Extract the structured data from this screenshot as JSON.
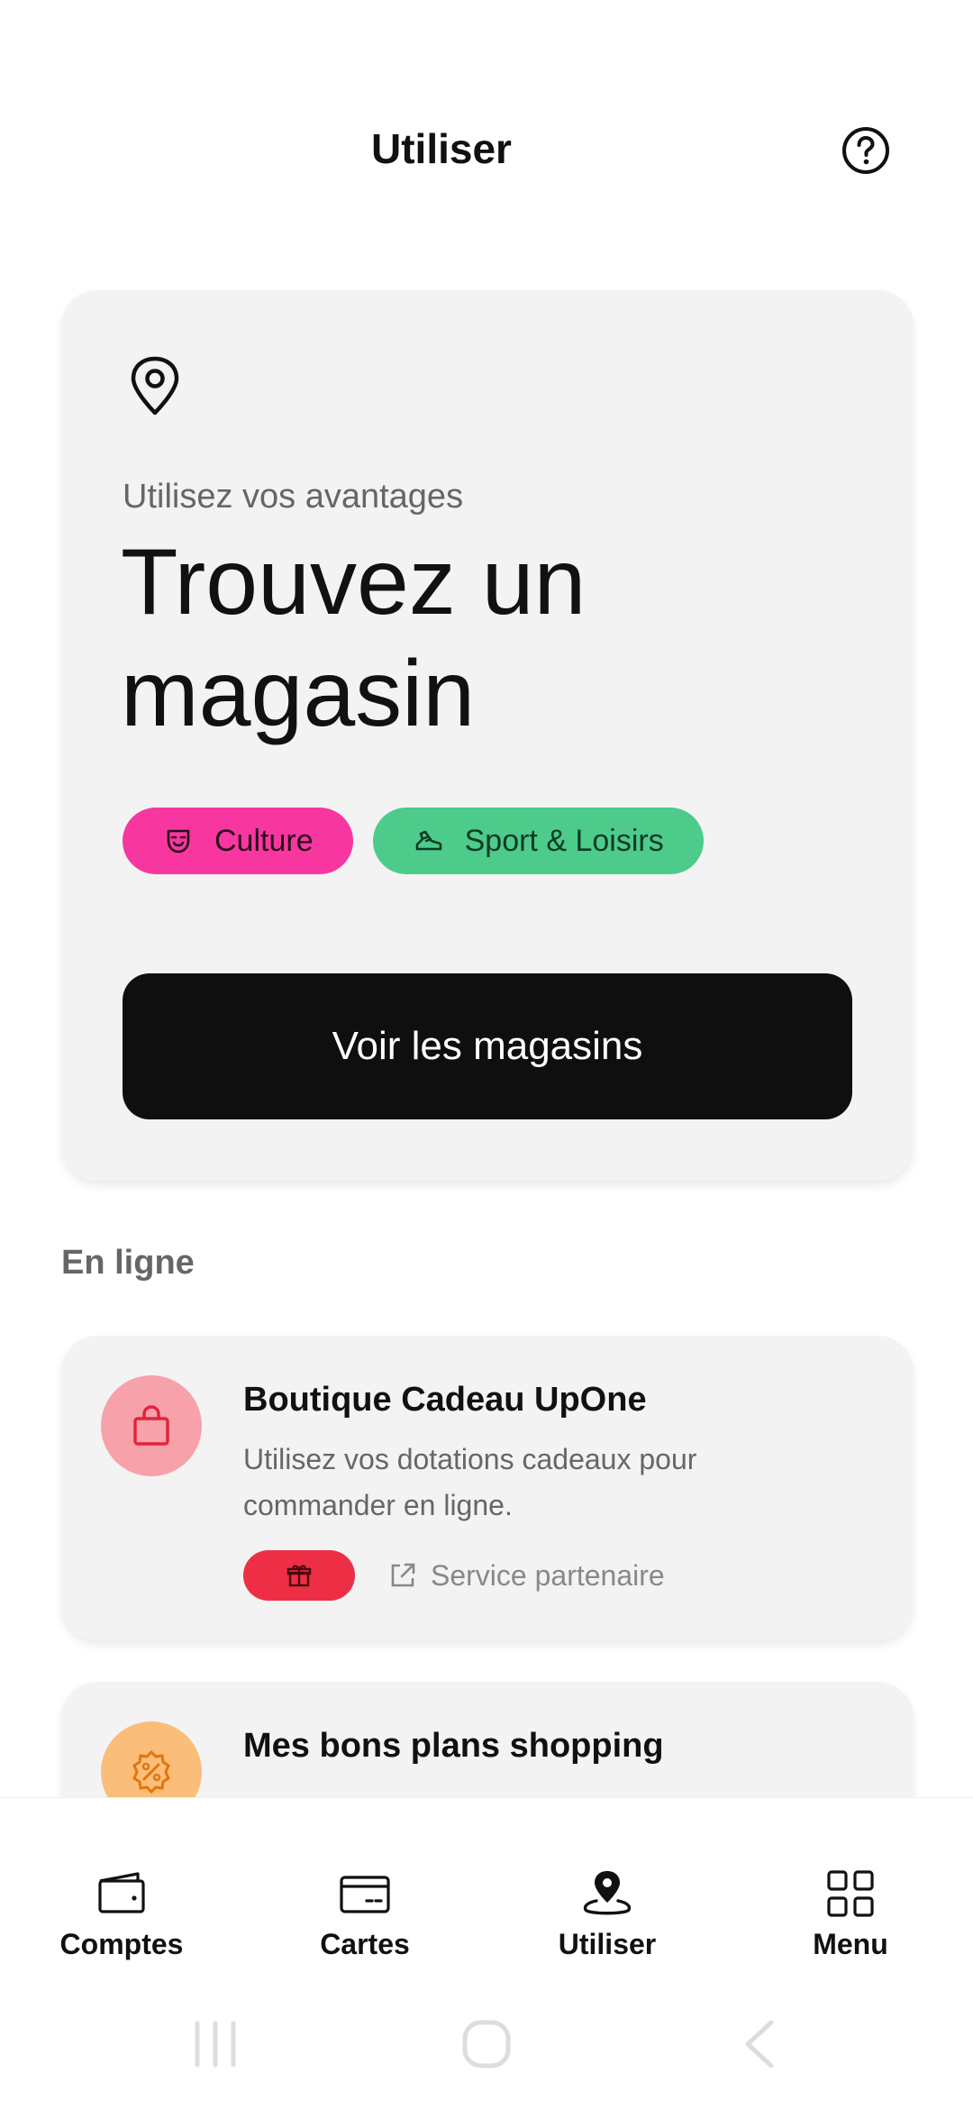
{
  "header": {
    "title": "Utiliser",
    "help_icon": "help-circle-icon"
  },
  "store_card": {
    "icon": "map-pin-icon",
    "subtitle": "Utilisez vos avantages",
    "title": "Trouvez un magasin",
    "chips": [
      {
        "label": "Culture",
        "icon": "theater-mask-icon",
        "color": "#f7379f"
      },
      {
        "label": "Sport & Loisirs",
        "icon": "sneaker-icon",
        "color": "#4ccb8b"
      }
    ],
    "button_label": "Voir les magasins"
  },
  "online": {
    "section_title": "En ligne",
    "items": [
      {
        "title": "Boutique Cadeau UpOne",
        "description": "Utilisez vos dotations cadeaux pour commander en ligne.",
        "icon": "shopping-bag-icon",
        "badge_icon": "gift-icon",
        "partner_label": "Service partenaire",
        "partner_icon": "external-link-icon"
      },
      {
        "title": "Mes bons plans shopping",
        "icon": "discount-badge-icon"
      }
    ]
  },
  "bottom_nav": {
    "items": [
      {
        "label": "Comptes",
        "icon": "wallet-icon",
        "active": false
      },
      {
        "label": "Cartes",
        "icon": "card-icon",
        "active": false
      },
      {
        "label": "Utiliser",
        "icon": "location-pin-icon",
        "active": true
      },
      {
        "label": "Menu",
        "icon": "grid-icon",
        "active": false
      }
    ]
  },
  "colors": {
    "card_bg": "#f3f3f3",
    "primary_button": "#0f0f0f",
    "culture": "#f7379f",
    "sport": "#4ccb8b",
    "gift": "#ee2e45",
    "bag_circle": "#f7a1aa",
    "discount_circle": "#fbbd7a"
  }
}
